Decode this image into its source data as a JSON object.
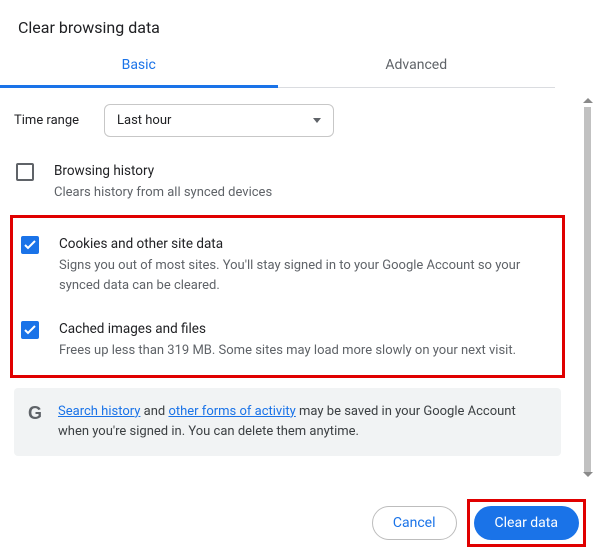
{
  "dialog": {
    "title": "Clear browsing data",
    "tabs": {
      "basic": "Basic",
      "advanced": "Advanced"
    },
    "time": {
      "label": "Time range",
      "value": "Last hour"
    },
    "options": {
      "browsing": {
        "title": "Browsing history",
        "desc": "Clears history from all synced devices"
      },
      "cookies": {
        "title": "Cookies and other site data",
        "desc": "Signs you out of most sites. You'll stay signed in to your Google Account so your synced data can be cleared."
      },
      "cache": {
        "title": "Cached images and files",
        "desc": "Frees up less than 319 MB. Some sites may load more slowly on your next visit."
      }
    },
    "info": {
      "pre": "",
      "link1": "Search history",
      "mid": " and ",
      "link2": "other forms of activity",
      "post": " may be saved in your Google Account when you're signed in. You can delete them anytime."
    },
    "buttons": {
      "cancel": "Cancel",
      "clear": "Clear data"
    }
  }
}
